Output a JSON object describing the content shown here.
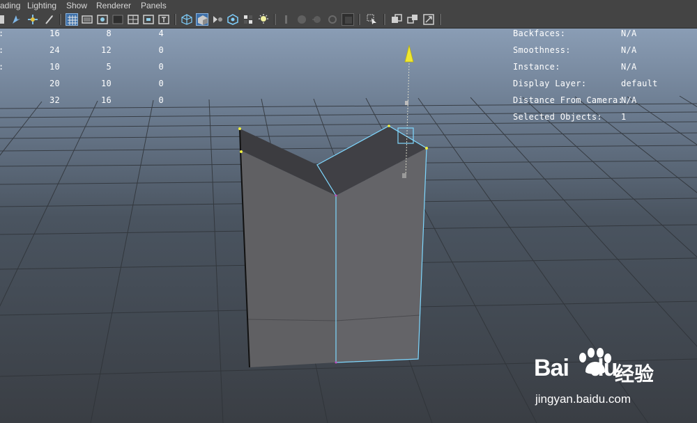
{
  "menubar": {
    "items": [
      "ading",
      "Lighting",
      "Show",
      "Renderer",
      "Panels"
    ]
  },
  "toolbar": {
    "icons": [
      "select-tool-icon",
      "paint-tool-icon",
      "move-tool-icon",
      "script-tool-icon",
      "grid-icon",
      "film-gate-icon",
      "resolution-gate-icon",
      "gate-mask-icon",
      "field-chart-icon",
      "safe-action-icon",
      "safe-title-icon",
      "wireframe-icon",
      "smooth-shade-icon",
      "default-material-icon",
      "xray-icon",
      "textured-icon",
      "lights-icon",
      "shadows-icon",
      "ambient-occlusion-icon",
      "motion-blur-icon",
      "anti-alias-icon",
      "depth-of-field-icon",
      "isolate-select-icon",
      "xray-active-icon",
      "xray-joints-icon",
      "backface-icon"
    ],
    "accent": "#3d8fd6"
  },
  "hud_left": {
    "rows": [
      [
        ":",
        "16",
        "8",
        "4"
      ],
      [
        ":",
        "24",
        "12",
        "0"
      ],
      [
        ":",
        "10",
        "5",
        "0"
      ],
      [
        "",
        "20",
        "10",
        "0"
      ],
      [
        "",
        "32",
        "16",
        "0"
      ]
    ]
  },
  "hud_right": {
    "rows": [
      {
        "label": "Backfaces:",
        "value": "N/A"
      },
      {
        "label": "Smoothness:",
        "value": "N/A"
      },
      {
        "label": "Instance:",
        "value": "N/A"
      },
      {
        "label": "Display Layer:",
        "value": "default"
      },
      {
        "label": "Distance From Camera:",
        "value": "N/A"
      },
      {
        "label": "Selected Objects:",
        "value": "1"
      }
    ]
  },
  "scene": {
    "object_color": "#5f5f61",
    "selection_color": "#7fd8ff",
    "manipulator_color": "#e8e020"
  },
  "watermark": {
    "logo": "Bai",
    "logo2": "du",
    "cn": "经验",
    "url": "jingyan.baidu.com"
  }
}
